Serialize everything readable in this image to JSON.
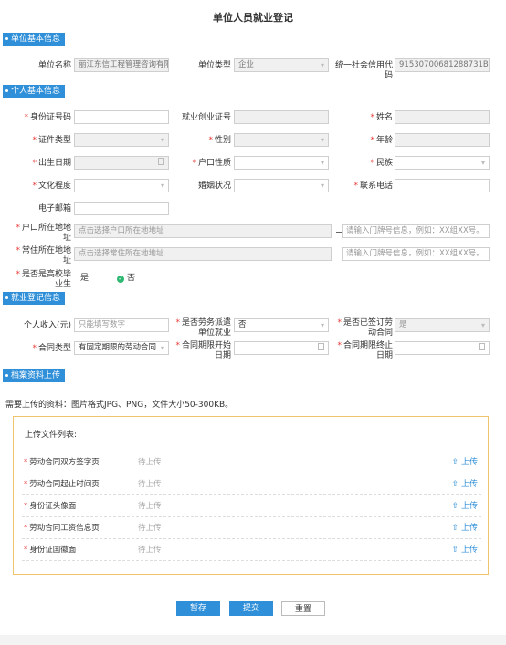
{
  "page_title": "单位人员就业登记",
  "sections": {
    "unit": "单位基本信息",
    "personal": "个人基本信息",
    "employment": "就业登记信息",
    "files": "档案资料上传"
  },
  "unit": {
    "name_label": "单位名称",
    "name_value": "丽江东信工程管理咨询有限",
    "type_label": "单位类型",
    "type_value": "企业",
    "credit_label_1": "统一社会信用代",
    "credit_label_2": "码",
    "credit_value": "91530700681288731B"
  },
  "personal": {
    "id_label": "身份证号码",
    "cert_label": "就业创业证号",
    "name_label": "姓名",
    "idtype_label": "证件类型",
    "gender_label": "性别",
    "age_label": "年龄",
    "birth_label": "出生日期",
    "hukou_label": "户口性质",
    "ethnic_label": "民族",
    "edu_label": "文化程度",
    "marital_label": "婚姻状况",
    "phone_label": "联系电话",
    "email_label": "电子邮箱",
    "reg_addr_label_1": "户口所在地地",
    "reg_addr_label_2": "址",
    "reg_addr_placeholder": "点击选择户口所在地地址",
    "reg_door_placeholder": "请输入门牌号信息，例如：XX组XX号。",
    "res_addr_label_1": "常住所在地地",
    "res_addr_label_2": "址",
    "res_addr_placeholder": "点击选择常住所在地地址",
    "res_door_placeholder": "请输入门牌号信息，例如：XX组XX号。",
    "grad_label_1": "是否是高校毕",
    "grad_label_2": "业生",
    "grad_yes": "是",
    "grad_no": "否"
  },
  "employment": {
    "income_label": "个人收入(元)",
    "income_placeholder": "只能填写数字",
    "dispatch_label_1": "是否劳务派遣",
    "dispatch_label_2": "单位就业",
    "dispatch_value": "否",
    "signed_label_1": "是否已签订劳",
    "signed_label_2": "动合同",
    "signed_value": "是",
    "contract_type_label": "合同类型",
    "contract_type_value": "有固定期限的劳动合同",
    "start_label_1": "合同期限开始",
    "start_label_2": "日期",
    "end_label_1": "合同期限终止",
    "end_label_2": "日期"
  },
  "upload": {
    "note": "需要上传的资料：图片格式JPG、PNG，文件大小50-300KB。",
    "list_title": "上传文件列表:",
    "status": "待上传",
    "action": "上传",
    "action_icon": "upload-icon",
    "files": [
      "劳动合同双方签字页",
      "劳动合同起止时间页",
      "身份证头像面",
      "劳动合同工资信息页",
      "身份证国徽面"
    ]
  },
  "buttons": {
    "save": "暂存",
    "submit": "提交",
    "reset": "重置"
  },
  "colors": {
    "primary": "#2f8fd8",
    "required": "#e53935",
    "success": "#2eb872",
    "upload_border": "#f0c36d"
  }
}
